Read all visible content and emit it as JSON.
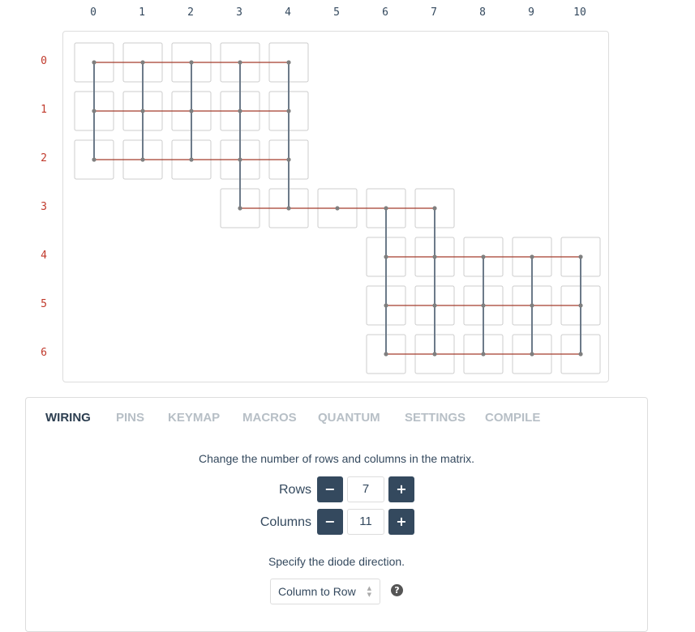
{
  "matrix": {
    "column_labels": [
      "0",
      "1",
      "2",
      "3",
      "4",
      "5",
      "6",
      "7",
      "8",
      "9",
      "10"
    ],
    "row_labels": [
      "0",
      "1",
      "2",
      "3",
      "4",
      "5",
      "6"
    ],
    "keys": [
      {
        "row": 0,
        "col": 0
      },
      {
        "row": 0,
        "col": 1
      },
      {
        "row": 0,
        "col": 2
      },
      {
        "row": 0,
        "col": 3
      },
      {
        "row": 0,
        "col": 4
      },
      {
        "row": 1,
        "col": 0
      },
      {
        "row": 1,
        "col": 1
      },
      {
        "row": 1,
        "col": 2
      },
      {
        "row": 1,
        "col": 3
      },
      {
        "row": 1,
        "col": 4
      },
      {
        "row": 2,
        "col": 0
      },
      {
        "row": 2,
        "col": 1
      },
      {
        "row": 2,
        "col": 2
      },
      {
        "row": 2,
        "col": 3
      },
      {
        "row": 2,
        "col": 4
      },
      {
        "row": 3,
        "col": 3
      },
      {
        "row": 3,
        "col": 4
      },
      {
        "row": 3,
        "col": 5
      },
      {
        "row": 3,
        "col": 6
      },
      {
        "row": 3,
        "col": 7
      },
      {
        "row": 4,
        "col": 6
      },
      {
        "row": 4,
        "col": 7
      },
      {
        "row": 4,
        "col": 8
      },
      {
        "row": 4,
        "col": 9
      },
      {
        "row": 4,
        "col": 10
      },
      {
        "row": 5,
        "col": 6
      },
      {
        "row": 5,
        "col": 7
      },
      {
        "row": 5,
        "col": 8
      },
      {
        "row": 5,
        "col": 9
      },
      {
        "row": 5,
        "col": 10
      },
      {
        "row": 6,
        "col": 6
      },
      {
        "row": 6,
        "col": 7
      },
      {
        "row": 6,
        "col": 8
      },
      {
        "row": 6,
        "col": 9
      },
      {
        "row": 6,
        "col": 10
      }
    ],
    "colors": {
      "row_wire": "#a33c2c",
      "column_wire": "#6c7a89",
      "node": "#7f7f7f",
      "row_label": "#c0392b",
      "column_label": "#34495e"
    }
  },
  "tabs": [
    {
      "label": "WIRING",
      "active": true
    },
    {
      "label": "PINS",
      "active": false
    },
    {
      "label": "KEYMAP",
      "active": false
    },
    {
      "label": "MACROS",
      "active": false
    },
    {
      "label": "QUANTUM",
      "active": false
    },
    {
      "label": "SETTINGS",
      "active": false
    },
    {
      "label": "COMPILE",
      "active": false
    }
  ],
  "wiring": {
    "matrix_hint": "Change the number of rows and columns in the matrix.",
    "rows": {
      "label": "Rows",
      "value": "7"
    },
    "columns": {
      "label": "Columns",
      "value": "11"
    },
    "decrement_icon": "minus-icon",
    "increment_icon": "plus-icon",
    "diode_hint": "Specify the diode direction.",
    "diode_direction": "Column to Row",
    "help_icon": "question-circle-icon"
  },
  "theme": {
    "accent": "#34495e",
    "active_tab": "#2c3e50",
    "inactive_tab": "#b7bfc6"
  }
}
